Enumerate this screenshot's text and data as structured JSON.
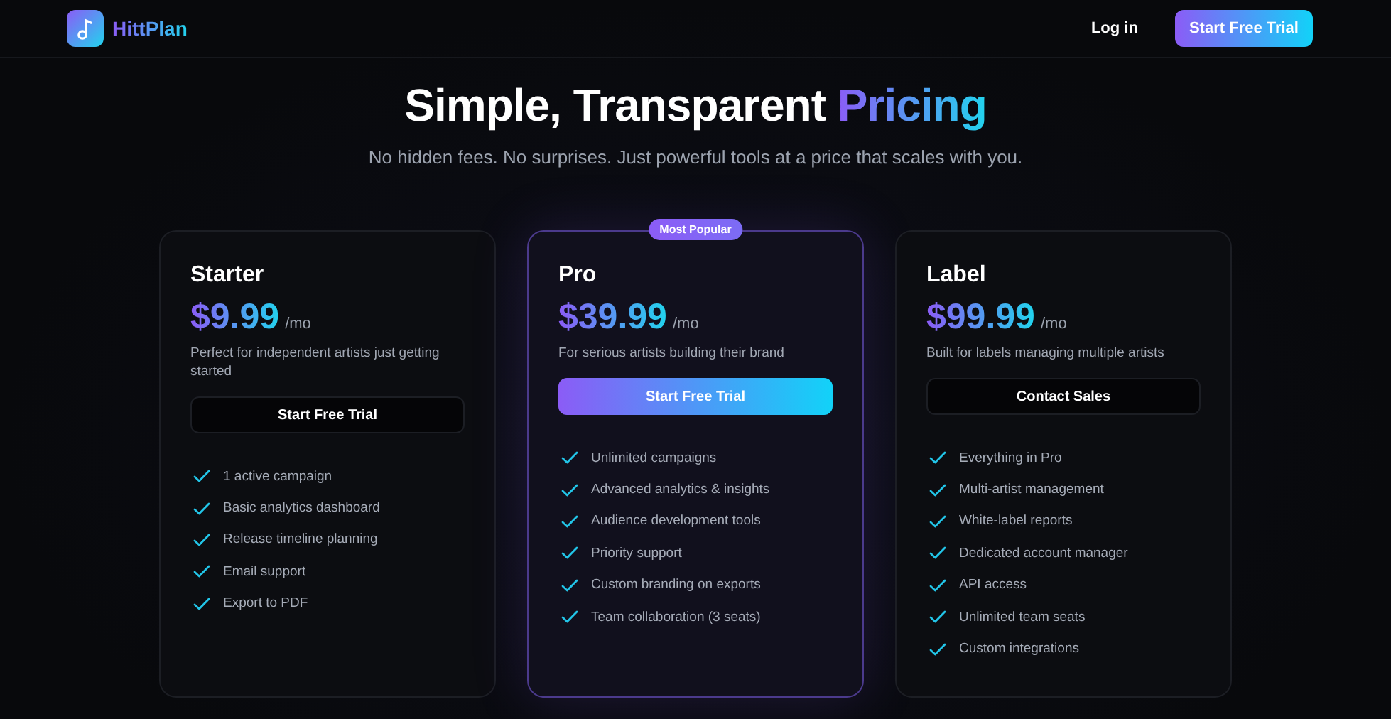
{
  "nav": {
    "brand": "HittPlan",
    "login": "Log in",
    "cta": "Start Free Trial"
  },
  "hero": {
    "title": "Simple, Transparent",
    "title_highlight": "Pricing",
    "subtitle": "No hidden fees. No surprises. Just powerful tools at a price that scales with you."
  },
  "plans": [
    {
      "name": "Starter",
      "price": "$9.99",
      "period": "/mo",
      "description": "Perfect for independent artists just getting started",
      "featured": false,
      "button": {
        "label": "Start Free Trial",
        "kind": "secondary"
      },
      "features": [
        "1 active campaign",
        "Basic analytics dashboard",
        "Release timeline planning",
        "Email support",
        "Export to PDF"
      ]
    },
    {
      "name": "Pro",
      "badge": "Most Popular",
      "price": "$39.99",
      "period": "/mo",
      "description": "For serious artists building their brand",
      "featured": true,
      "button": {
        "label": "Start Free Trial",
        "kind": "primary"
      },
      "features": [
        "Unlimited campaigns",
        "Advanced analytics & insights",
        "Audience development tools",
        "Priority support",
        "Custom branding on exports",
        "Team collaboration (3 seats)"
      ]
    },
    {
      "name": "Label",
      "price": "$99.99",
      "period": "/mo",
      "description": "Built for labels managing multiple artists",
      "featured": false,
      "button": {
        "label": "Contact Sales",
        "kind": "secondary"
      },
      "features": [
        "Everything in Pro",
        "Multi-artist management",
        "White-label reports",
        "Dedicated account manager",
        "API access",
        "Unlimited team seats",
        "Custom integrations"
      ]
    }
  ]
}
